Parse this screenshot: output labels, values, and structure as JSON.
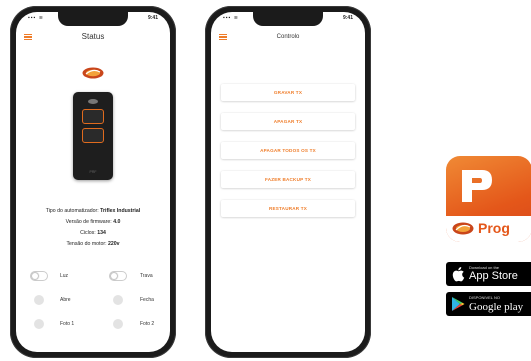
{
  "status_phone": {
    "statusbar_time": "9:41",
    "title": "Status",
    "info": {
      "tipo_label": "Tipo do automatizador:",
      "tipo_value": "Triflex Industrial",
      "firmware_label": "Versão de firmware:",
      "firmware_value": "4.0",
      "ciclos_label": "Ciclos:",
      "ciclos_value": "134",
      "tensao_label": "Tensão do motor:",
      "tensao_value": "220v"
    },
    "remote_brand": "PRF",
    "controls": {
      "luz": "Luz",
      "trava": "Trava",
      "abre": "Abre",
      "fecha": "Fecha",
      "foto1": "Foto 1",
      "foto2": "Foto 2"
    }
  },
  "controlo_phone": {
    "statusbar_time": "9:41",
    "title": "Controlo",
    "buttons": [
      "GRAVAR TX",
      "APAGAR TX",
      "APAGAR TODOS OS TX",
      "FAZER BACKUP TX",
      "RESTAURAR TX"
    ]
  },
  "app_icon": {
    "name": "Prog"
  },
  "stores": {
    "appstore_small": "Download on the",
    "appstore_big": "App Store",
    "play_small": "DISPONIVEL NO",
    "play_big": "Google play"
  },
  "colors": {
    "accent": "#ef7d2a",
    "app_icon_gradient_top": "#f08a35",
    "app_icon_gradient_bottom": "#d7461a",
    "phone_frame": "#1b1b1b"
  },
  "icons": [
    "menu-icon",
    "brand-logo",
    "apple-icon",
    "google-play-icon"
  ]
}
